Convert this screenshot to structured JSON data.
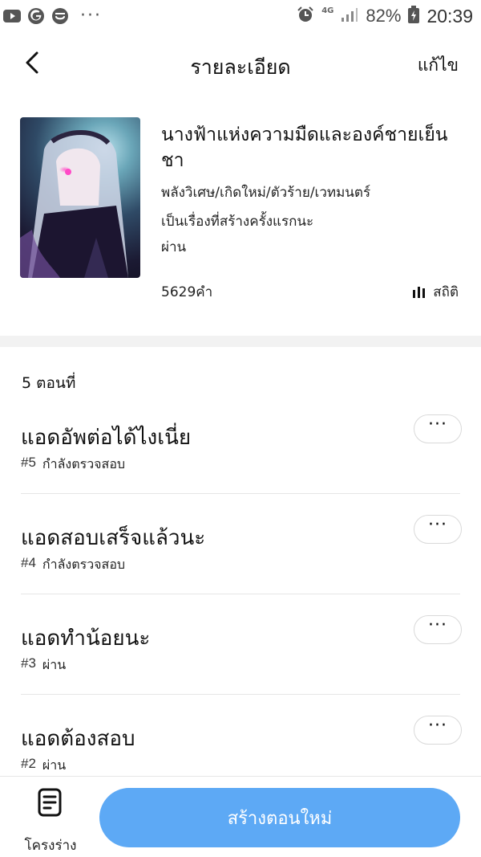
{
  "status_bar": {
    "apps": [
      "youtube-icon",
      "google-icon",
      "smile-app-icon"
    ],
    "more": "···",
    "network": "4G",
    "battery_percent": "82%",
    "time": "20:39"
  },
  "nav": {
    "title": "รายละเอียด",
    "edit_label": "แก้ไข"
  },
  "story": {
    "title": "นางฟ้าแห่งความมืดและองค์ชายเย็นชา",
    "genres": "พลังวิเศษ/เกิดใหม่/ตัวร้าย/เวทมนตร์",
    "note": "เป็นเรื่องที่สร้างครั้งแรกนะ",
    "status": "ผ่าน",
    "word_count": "5629คำ",
    "stats_label": "สถิติ"
  },
  "episodes": {
    "count_label": "5 ตอนที่",
    "more_label": "···",
    "items": [
      {
        "title": "แอดอัพต่อได้ไงเนี่ย",
        "number": "#5",
        "status": "กำลังตรวจสอบ"
      },
      {
        "title": "แอดสอบเสร็จแล้วนะ",
        "number": "#4",
        "status": "กำลังตรวจสอบ"
      },
      {
        "title": "แอดทำน้อยนะ",
        "number": "#3",
        "status": "ผ่าน"
      },
      {
        "title": "แอดต้องสอบ",
        "number": "#2",
        "status": "ผ่าน"
      }
    ]
  },
  "bottom": {
    "outline_label": "โครงร่าง",
    "create_label": "สร้างตอนใหม่"
  },
  "colors": {
    "primary_button": "#5da9f5",
    "divider": "#e6e6e6",
    "section_gap": "#f2f2f2"
  }
}
